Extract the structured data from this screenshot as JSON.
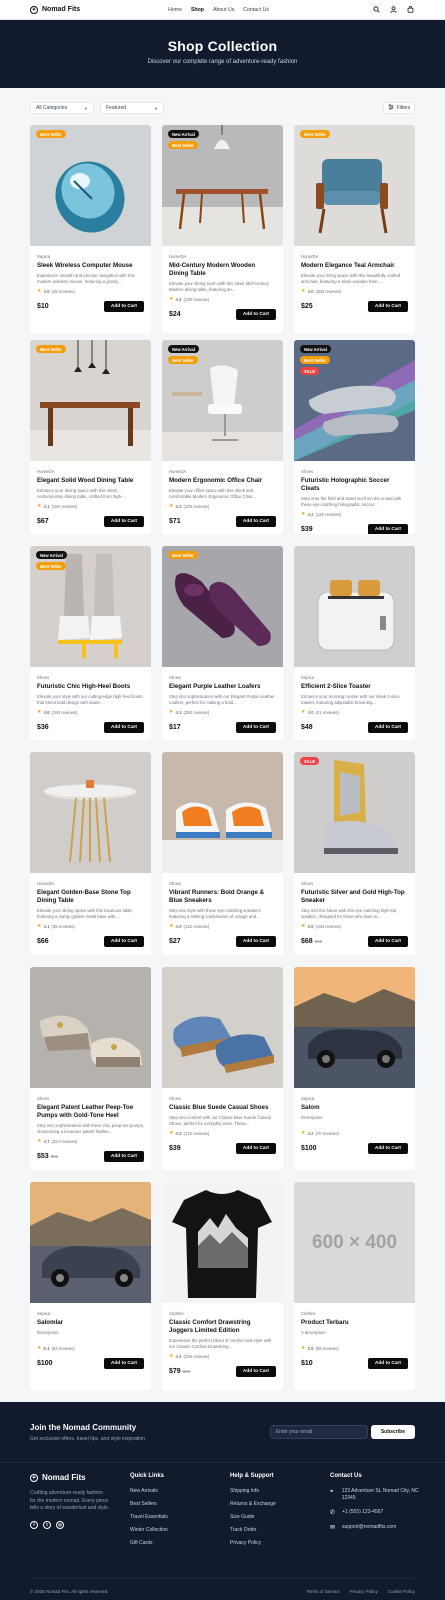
{
  "brand": "Nomad Fits",
  "nav": {
    "links": [
      "Home",
      "Shop",
      "About Us",
      "Contact Us"
    ],
    "active": "Shop"
  },
  "hero": {
    "title": "Shop Collection",
    "subtitle": "Discover our complete range of adventure-ready fashion"
  },
  "filters": {
    "category": "All Categories",
    "sort": "Featured",
    "button": "Filters"
  },
  "add_to_cart": "Add to Cart",
  "products": [
    {
      "category": "Sepica",
      "name": "Sleek Wireless Computer Mouse",
      "desc": "Experience smooth and precise navigation with this modern wireless mouse, featuring a glossy...",
      "rating": "4.8",
      "reviews": "(45 reviews)",
      "price": "$10",
      "old_price": "",
      "badges": [
        "Best Seller"
      ]
    },
    {
      "category": "HumeDA",
      "name": "Mid-Century Modern Wooden Dining Table",
      "desc": "Elevate your dining room with this sleek Mid-Century Modern dining table, featuring an...",
      "rating": "4.4",
      "reviews": "(130 reviews)",
      "price": "$24",
      "old_price": "",
      "badges": [
        "New Arrival",
        "Best Seller"
      ]
    },
    {
      "category": "HumeDA",
      "name": "Modern Elegance Teal Armchair",
      "desc": "Elevate your living space with this beautifully crafted armchair, featuring a sleek wooden fram...",
      "rating": "4.0",
      "reviews": "(300 reviews)",
      "price": "$25",
      "old_price": "",
      "badges": [
        "Best Seller"
      ]
    },
    {
      "category": "HumeDA",
      "name": "Elegant Solid Wood Dining Table",
      "desc": "Enhance your dining space with this sleek, contemporary dining table, crafted from high-...",
      "rating": "3.1",
      "reviews": "(150 reviews)",
      "price": "$67",
      "old_price": "",
      "badges": [
        "Best Seller"
      ]
    },
    {
      "category": "HumeDA",
      "name": "Modern Ergonomic Office Chair",
      "desc": "Elevate your office space with this sleek and comfortable Modern Ergonomic Office Chair...",
      "rating": "3.3",
      "reviews": "(106 reviews)",
      "price": "$71",
      "old_price": "",
      "badges": [
        "New Arrival",
        "Best Seller"
      ]
    },
    {
      "category": "Shoes",
      "name": "Futuristic Holographic Soccer Cleats",
      "desc": "Step onto the field and stand out from the crowd with these eye-catching holographic soccer...",
      "rating": "4.2",
      "reviews": "(120 reviews)",
      "price": "$39",
      "old_price": "",
      "badges": [
        "New Arrival",
        "Best Seller",
        "SALE"
      ]
    },
    {
      "category": "Shoes",
      "name": "Futuristic Chic High-Heel Boots",
      "desc": "Elevate your style with our cutting-edge high-heel boots that blend bold design with avant-...",
      "rating": "4.8",
      "reviews": "(150 reviews)",
      "price": "$36",
      "old_price": "",
      "badges": [
        "New Arrival",
        "Best Seller"
      ]
    },
    {
      "category": "Shoes",
      "name": "Elegant Purple Leather Loafers",
      "desc": "Step into sophistication with our Elegant Purple Leather Loafers, perfect for making a bold...",
      "rating": "4.3",
      "reviews": "(250 reviews)",
      "price": "$17",
      "old_price": "",
      "badges": [
        "Best Seller"
      ]
    },
    {
      "category": "Sepica",
      "name": "Efficient 2-Slice Toaster",
      "desc": "Enhance your morning routine with our sleek 2-slice toaster, featuring adjustable browning...",
      "rating": "4.0",
      "reviews": "(41 reviews)",
      "price": "$48",
      "old_price": "",
      "badges": []
    },
    {
      "category": "HumeDA",
      "name": "Elegant Golden-Base Stone Top Dining Table",
      "desc": "Elevate your dining space with this luxurious table, featuring a sturdy golden metal base with...",
      "rating": "3.1",
      "reviews": "(35 reviews)",
      "price": "$66",
      "old_price": "",
      "badges": []
    },
    {
      "category": "Shoes",
      "name": "Vibrant Runners: Bold Orange & Blue Sneakers",
      "desc": "Step into style with these eye-catching sneakers featuring a striking combination of orange and...",
      "rating": "4.0",
      "reviews": "(122 reviews)",
      "price": "$27",
      "old_price": "",
      "badges": []
    },
    {
      "category": "Shoes",
      "name": "Futuristic Silver and Gold High-Top Sneaker",
      "desc": "Step into the future with this eye-catching high-top sneaker, designed for those who dare to...",
      "rating": "3.6",
      "reviews": "(194 reviews)",
      "price": "$68",
      "old_price": "$90",
      "badges": [
        "SALE"
      ]
    },
    {
      "category": "Shoes",
      "name": "Elegant Patent Leather Peep-Toe Pumps with Gold-Tone Heel",
      "desc": "Step into sophistication with these chic peep-toe pumps, showcasing a luxurious patent leather...",
      "rating": "4.7",
      "reviews": "(324 reviews)",
      "price": "$53",
      "old_price": "$65",
      "badges": []
    },
    {
      "category": "Shoes",
      "name": "Classic Blue Suede Casual Shoes",
      "desc": "Step into comfort with our Classic Blue Suede Casual Shoes, perfect for everyday wear. These...",
      "rating": "4.3",
      "reviews": "(176 reviews)",
      "price": "$39",
      "old_price": "",
      "badges": []
    },
    {
      "category": "Sepica",
      "name": "Salom",
      "desc": "Description",
      "rating": "4.2",
      "reviews": "(70 reviews)",
      "price": "$100",
      "old_price": "",
      "badges": []
    },
    {
      "category": "Sepica",
      "name": "Salomlar",
      "desc": "Description",
      "rating": "5.4",
      "reviews": "(63 reviews)",
      "price": "$100",
      "old_price": "",
      "badges": []
    },
    {
      "category": "Clothes",
      "name": "Classic Comfort Drawstring Joggers Limited Edition",
      "desc": "Experience the perfect blend of comfort and style with our Classic Comfort Drawstring...",
      "rating": "4.4",
      "reviews": "(205 reviews)",
      "price": "$79",
      "old_price": "$93",
      "badges": []
    },
    {
      "category": "Clothes",
      "name": "Product Terbaru",
      "desc": "A description",
      "rating": "3.5",
      "reviews": "(58 reviews)",
      "price": "$10",
      "old_price": "",
      "badges": []
    }
  ],
  "placeholder_image_text": "600 × 400",
  "newsletter": {
    "title": "Join the Nomad Community",
    "subtitle": "Get exclusive offers, travel tips, and style inspiration",
    "placeholder": "Enter your email",
    "button": "Subscribe"
  },
  "footer": {
    "brand": "Nomad Fits",
    "description": "Crafting adventure-ready fashion for the modern nomad. Every piece tells a story of wanderlust and style.",
    "quick_links_title": "Quick Links",
    "quick_links": [
      "New Arrivals",
      "Best Sellers",
      "Travel Essentials",
      "Winter Collection",
      "Gift Cards"
    ],
    "help_title": "Help & Support",
    "help_links": [
      "Shipping Info",
      "Returns & Exchange",
      "Size Guide",
      "Track Order",
      "Privacy Policy"
    ],
    "contact_title": "Contact Us",
    "address": "123 Adventure St, Nomad City, NC 12345",
    "phone": "+1 (555) 123-4567",
    "email": "support@nomadfits.com",
    "copyright": "© 2025 Nomad Fits. All rights reserved.",
    "legal": [
      "Terms of Service",
      "Privacy Policy",
      "Cookie Policy"
    ]
  }
}
